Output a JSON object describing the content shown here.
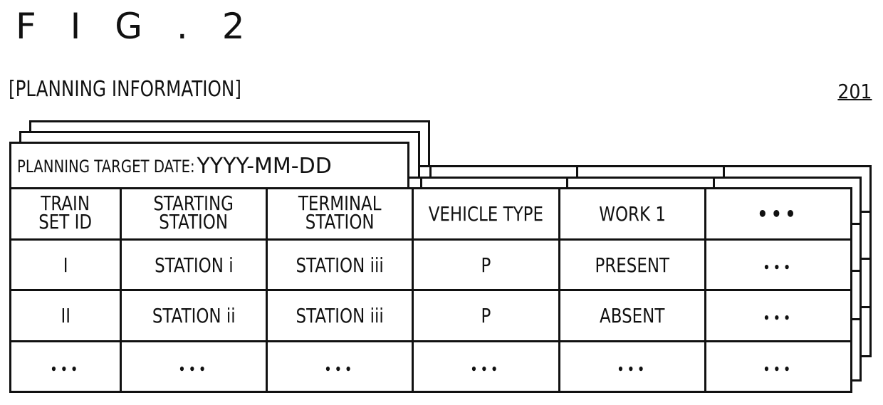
{
  "figure": {
    "title": "F I G . 2",
    "section_title": "[PLANNING INFORMATION]",
    "reference_number": "201"
  },
  "planning_sheet": {
    "target_date_label": "PLANNING TARGET DATE:",
    "target_date_value": "YYYY-MM-DD",
    "columns": [
      [
        "TRAIN",
        "SET ID"
      ],
      [
        "STARTING",
        "STATION"
      ],
      [
        "TERMINAL",
        "STATION"
      ],
      [
        "VEHICLE TYPE"
      ],
      [
        "WORK 1"
      ],
      [
        "•••"
      ]
    ],
    "rows": [
      [
        "I",
        "STATION i",
        "STATION iii",
        "P",
        "PRESENT",
        "•••"
      ],
      [
        "II",
        "STATION ii",
        "STATION iii",
        "P",
        "ABSENT",
        "•••"
      ],
      [
        "•••",
        "•••",
        "•••",
        "•••",
        "•••",
        "•••"
      ]
    ]
  }
}
